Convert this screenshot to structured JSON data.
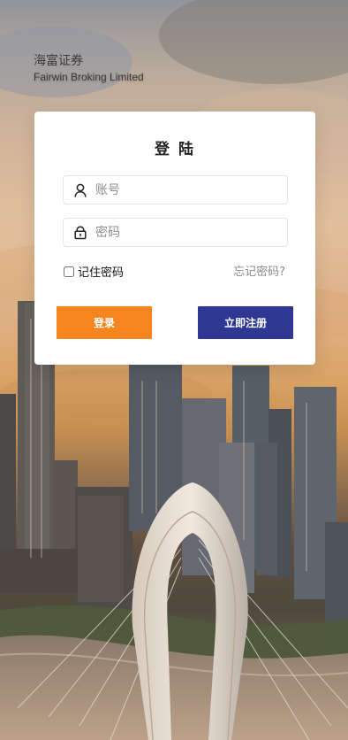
{
  "brand": {
    "name_cn": "海富证券",
    "name_en": "Fairwin Broking Limited"
  },
  "login": {
    "title": "登 陆",
    "username": {
      "placeholder": "账号",
      "icon": "user-icon"
    },
    "password": {
      "placeholder": "密码",
      "icon": "lock-icon"
    },
    "remember_label": "记住密码",
    "forgot_label": "忘记密码?",
    "login_button": "登录",
    "register_button": "立即注册"
  },
  "colors": {
    "login_button": "#f5861f",
    "register_button": "#2e3794"
  }
}
